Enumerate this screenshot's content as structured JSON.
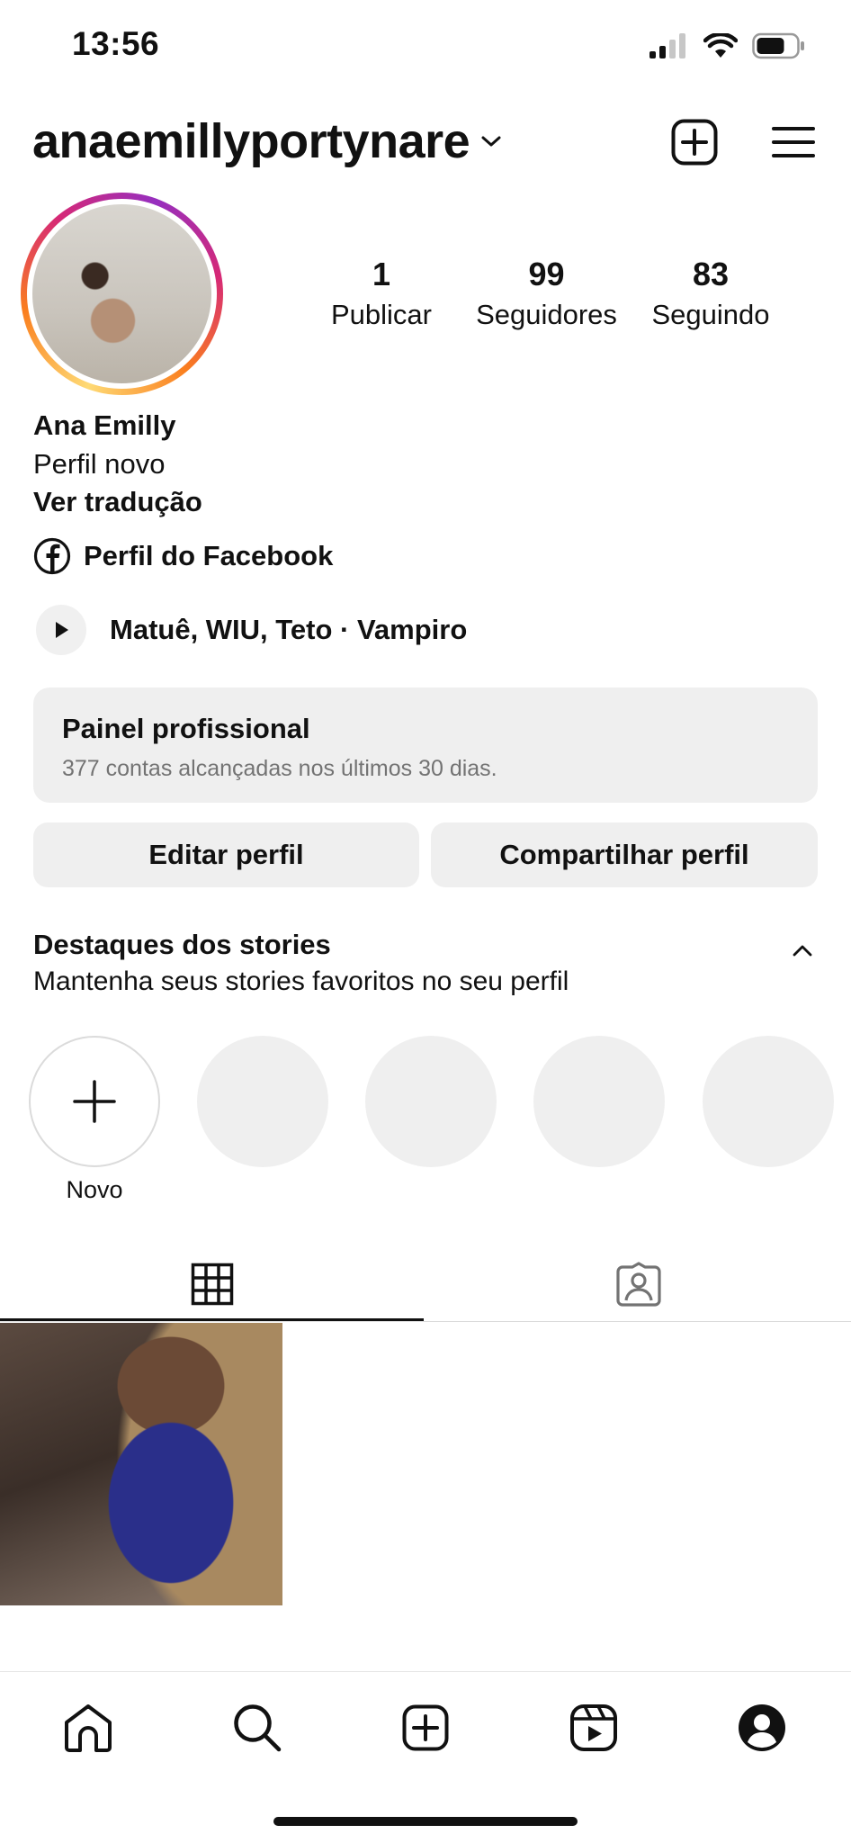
{
  "status_bar": {
    "time": "13:56"
  },
  "header": {
    "username": "anaemillyportynare"
  },
  "profile": {
    "stats": [
      {
        "value": "1",
        "label": "Publicar"
      },
      {
        "value": "99",
        "label": "Seguidores"
      },
      {
        "value": "83",
        "label": "Seguindo"
      }
    ],
    "name": "Ana Emilly",
    "bio": "Perfil novo",
    "translate_link": "Ver tradução",
    "facebook_link": "Perfil do Facebook",
    "music": "Matuê, WIU, Teto · Vampiro"
  },
  "dashboard": {
    "title": "Painel profissional",
    "subtitle": "377 contas alcançadas nos últimos 30 dias."
  },
  "buttons": {
    "edit": "Editar perfil",
    "share": "Compartilhar perfil"
  },
  "highlights": {
    "title": "Destaques dos stories",
    "subtitle": "Mantenha seus stories favoritos no seu perfil",
    "new_label": "Novo"
  },
  "tabs": {
    "active": "grid"
  },
  "bottom_nav": {
    "active": "profile"
  }
}
